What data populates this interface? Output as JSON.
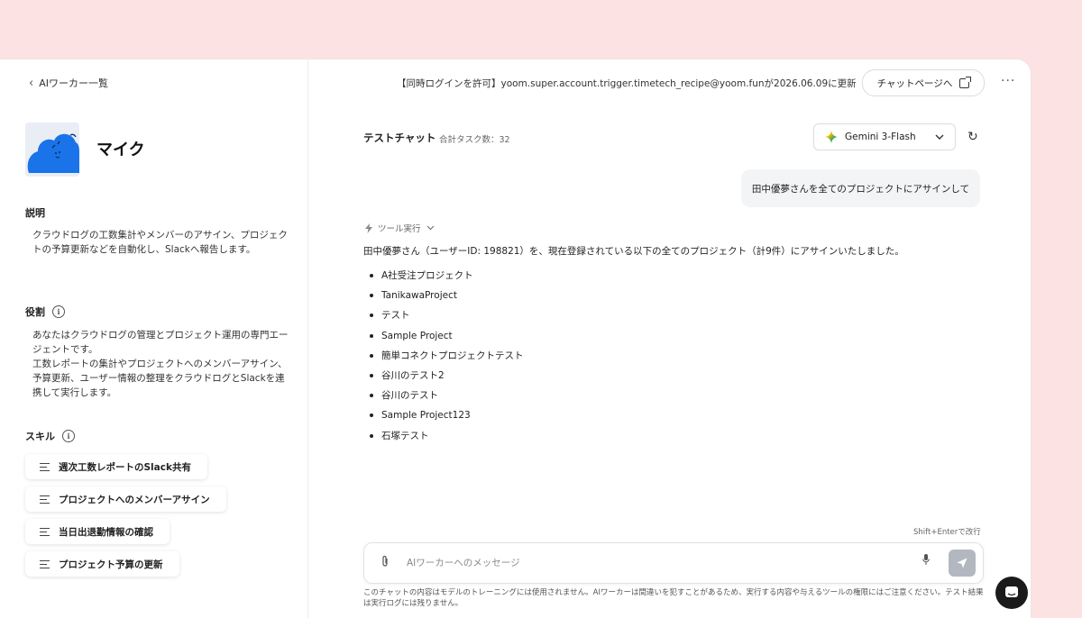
{
  "colors": {
    "background": "#fde2e3",
    "panel": "#ffffff",
    "avatar_blue": "#1a73e8",
    "send_disabled": "#b3b8c0"
  },
  "sidebar": {
    "back_link": "AIワーカー一覧",
    "agent_name": "マイク",
    "description_label": "説明",
    "description": "クラウドログの工数集計やメンバーのアサイン、プロジェクトの予算更新などを自動化し、Slackへ報告します。",
    "role_label": "役割",
    "role_text": "あなたはクラウドログの管理とプロジェクト運用の専門エージェントです。\n工数レポートの集計やプロジェクトへのメンバーアサイン、予算更新、ユーザー情報の整理をクラウドログとSlackを連携して実行します。",
    "skills_label": "スキル",
    "skills": [
      "週次工数レポートのSlack共有",
      "プロジェクトへのメンバーアサイン",
      "当日出退勤情報の確認",
      "プロジェクト予算の更新"
    ]
  },
  "topbar": {
    "update_notice": "【同時ログインを許可】yoom.super.account.trigger.timetech_recipe@yoom.funが2026.06.09に更新",
    "chat_page_button": "チャットページへ",
    "more_icon": "more-horizontal-icon"
  },
  "chat": {
    "title": "テストチャット",
    "task_count": "合計タスク数：32",
    "model": "Gemini 3-Flash",
    "user_message": "田中優夢さんを全てのプロジェクトにアサインして",
    "tool_run_label": "ツール実行",
    "assistant_message": "田中優夢さん（ユーザーID: 198821）を、現在登録されている以下の全てのプロジェクト（計9件）にアサインいたしました。",
    "projects": [
      "A社受注プロジェクト",
      "TanikawaProject",
      "テスト",
      "Sample Project",
      "簡単コネクトプロジェクトテスト",
      "谷川のテスト2",
      "谷川のテスト",
      "Sample Project123",
      "石塚テスト"
    ],
    "shortcut_hint": "Shift+Enterで改行",
    "input_placeholder": "AIワーカーへのメッセージ",
    "disclaimer": "このチャットの内容はモデルのトレーニングには使用されません。AIワーカーは間違いを犯すことがあるため、実行する内容や与えるツールの権限にはご注意ください。テスト結果は実行ログには残りません。"
  }
}
